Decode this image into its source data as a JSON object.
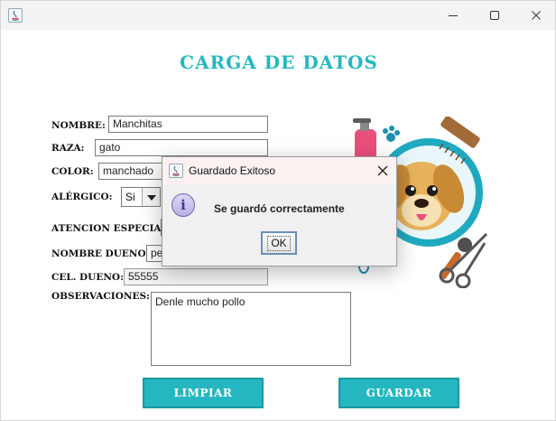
{
  "window": {
    "title": ""
  },
  "form": {
    "heading": "CARGA DE DATOS",
    "fields": {
      "nombre": {
        "label": "NOMBRE:",
        "value": "Manchitas"
      },
      "raza": {
        "label": "RAZA:",
        "value": "gato"
      },
      "color": {
        "label": "COLOR:",
        "value": "manchado"
      },
      "alergico": {
        "label": "ALÉRGICO:",
        "value": "Si"
      },
      "atencion_especial": {
        "label": "ATENCION ESPECIAL:",
        "value": ""
      },
      "nombre_dueno": {
        "label": "NOMBRE DUENO:",
        "value": "pe"
      },
      "cel_dueno": {
        "label": "CEL. DUENO:",
        "value": "55555"
      },
      "observaciones": {
        "label": "OBSERVACIONES:",
        "value": "Denle mucho pollo"
      }
    },
    "buttons": {
      "limpiar": "LIMPIAR",
      "guardar": "GUARDAR"
    }
  },
  "dialog": {
    "title": "Guardado Exitoso",
    "icon_letter": "i",
    "message": "Se guardó correctamente",
    "ok_label": "OK"
  },
  "colors": {
    "accent": "#25b7c1",
    "dialog_title_bg": "#fbf1f1"
  },
  "icons": [
    "java-icon",
    "minimize-icon",
    "maximize-icon",
    "close-icon",
    "info-icon",
    "chevron-down-icon",
    "dog-grooming-illustration"
  ]
}
